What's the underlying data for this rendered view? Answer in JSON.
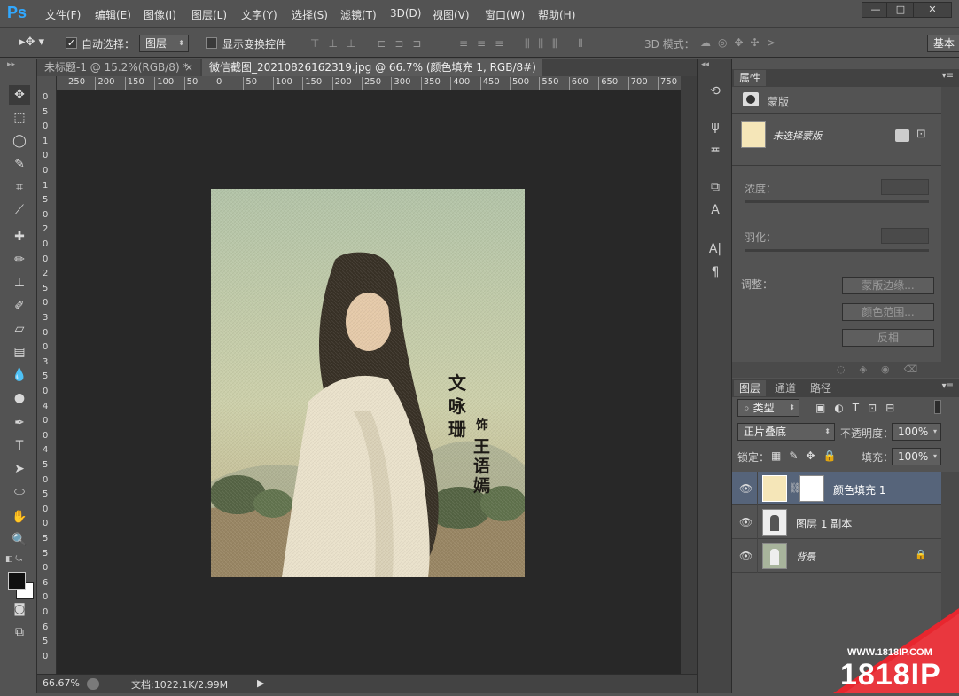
{
  "app": {
    "logo": "Ps"
  },
  "menu": [
    "文件(F)",
    "编辑(E)",
    "图像(I)",
    "图层(L)",
    "文字(Y)",
    "选择(S)",
    "滤镜(T)",
    "3D(D)",
    "视图(V)",
    "窗口(W)",
    "帮助(H)"
  ],
  "window_controls": {
    "minimize": "—",
    "maximize": "□",
    "close": "✕"
  },
  "options": {
    "auto_select_label": "自动选择：",
    "auto_select_target": "图层",
    "show_transform_label": "显示变换控件",
    "mode_3d_label": "3D 模式：",
    "workspace": "基本"
  },
  "tabs": [
    {
      "label": "未标题-1 @ 15.2%(RGB/8) *"
    },
    {
      "label": "微信截图_20210826162319.jpg @ 66.7% (颜色填充 1, RGB/8#) *"
    }
  ],
  "tab_close": "×",
  "ruler_h": [
    "250",
    "200",
    "150",
    "100",
    "50",
    "0",
    "50",
    "100",
    "150",
    "200",
    "250",
    "300",
    "350",
    "400",
    "450",
    "500",
    "550",
    "600",
    "650",
    "700",
    "750"
  ],
  "ruler_v": [
    "0",
    "5",
    "0",
    "1",
    "0",
    "0",
    "1",
    "5",
    "0",
    "2",
    "0",
    "0",
    "2",
    "5",
    "0",
    "3",
    "0",
    "0",
    "3",
    "5",
    "0",
    "4",
    "0",
    "0",
    "4",
    "5",
    "0",
    "5",
    "0",
    "0",
    "5",
    "5",
    "0",
    "6",
    "0",
    "0",
    "6",
    "5",
    "0"
  ],
  "image_text": {
    "title_col1": "文",
    "title_col2": "咏",
    "title_col3": "珊",
    "role": "饰",
    "actor1": "王",
    "actor2": "语",
    "actor3": "嫣"
  },
  "status": {
    "zoom": "66.67%",
    "doc_info": "文档:1022.1K/2.99M"
  },
  "properties": {
    "tab": "属性",
    "title": "蒙版",
    "no_mask": "未选择蒙版",
    "density_label": "浓度：",
    "feather_label": "羽化：",
    "adjust_label": "调整：",
    "btn_refine_edge": "蒙版边缘...",
    "btn_color_range": "颜色范围...",
    "btn_invert": "反相"
  },
  "layers_panel": {
    "tabs": [
      "图层",
      "通道",
      "路径"
    ],
    "filter_kind": "类型",
    "blend_mode": "正片叠底",
    "opacity_label": "不透明度：",
    "opacity_value": "100%",
    "lock_label": "锁定：",
    "fill_label": "填充：",
    "fill_value": "100%",
    "layers": [
      {
        "name": "颜色填充 1"
      },
      {
        "name": "图层 1 副本"
      },
      {
        "name": "背景"
      }
    ]
  },
  "watermark": {
    "url": "WWW.1818IP.COM",
    "brand": "1818IP"
  },
  "colors": {
    "accent": "#31a8ff",
    "fill_swatch": "#f5e6b8",
    "selected_row": "#56647a",
    "watermark_red": "#e8262e"
  }
}
